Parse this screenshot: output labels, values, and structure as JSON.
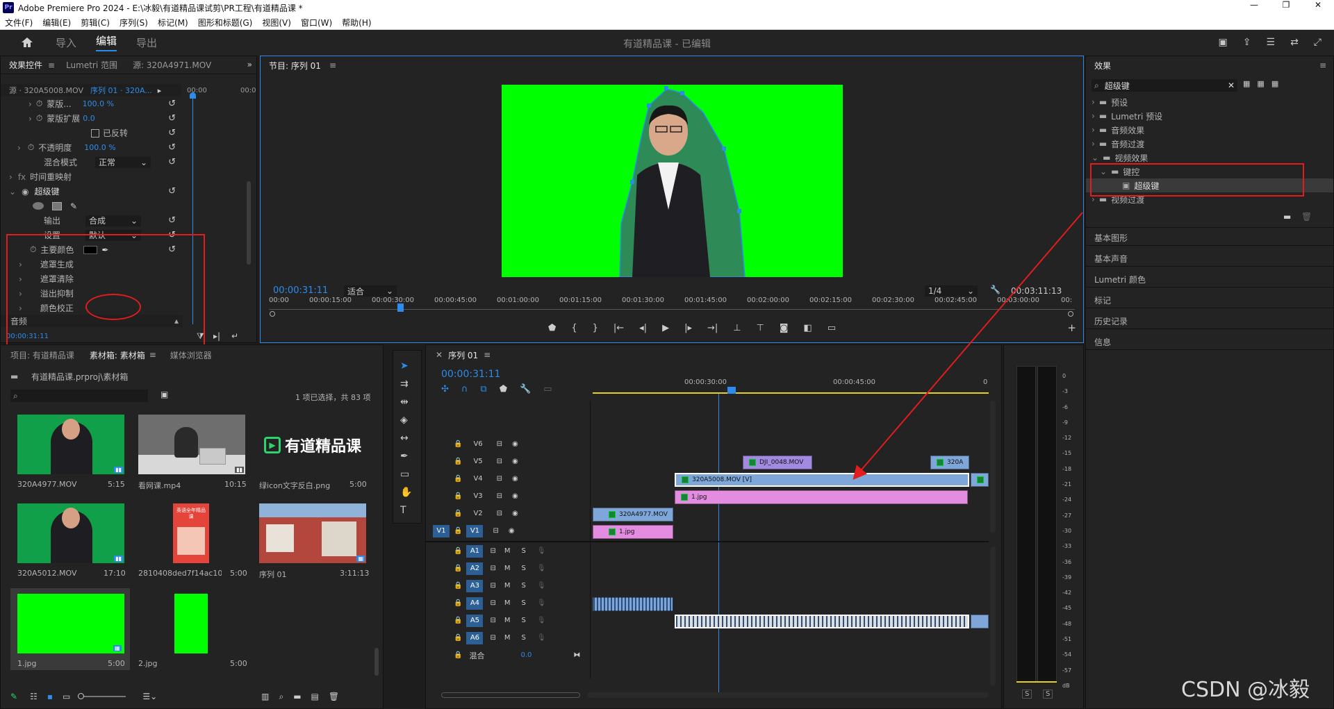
{
  "window": {
    "title": "Adobe Premiere Pro 2024 - E:\\冰毅\\有道精品课试剪\\PR工程\\有道精品课 *",
    "app_icon": "Pr"
  },
  "menu": [
    "文件(F)",
    "编辑(E)",
    "剪辑(C)",
    "序列(S)",
    "标记(M)",
    "图形和标题(G)",
    "视图(V)",
    "窗口(W)",
    "帮助(H)"
  ],
  "workspace": {
    "tabs": [
      "导入",
      "编辑",
      "导出"
    ],
    "active": "编辑",
    "project_title": "有道精品课 - 已编辑"
  },
  "effect_controls": {
    "tabs": [
      "效果控件",
      "Lumetri 范围",
      "源: 320A4971.MOV"
    ],
    "source_label": "源 · 320A5008.MOV",
    "sequence_label": "序列 01 · 320A...",
    "time_label": "00:00",
    "rows": [
      {
        "label": "蒙版...",
        "value": "100.0 %"
      },
      {
        "label": "蒙版扩展",
        "value": "0.0"
      },
      {
        "label": "已反转",
        "value": ""
      },
      {
        "label": "不透明度",
        "value": "100.0 %"
      },
      {
        "label": "混合模式",
        "value": "正常"
      },
      {
        "label": "时间重映射",
        "value": ""
      }
    ],
    "ultra_key": {
      "name": "超级键",
      "output_label": "输出",
      "output_value": "合成",
      "setting_label": "设置",
      "setting_value": "默认",
      "key_color_label": "主要颜色",
      "subitems": [
        "遮罩生成",
        "遮罩清除",
        "溢出抑制",
        "颜色校正"
      ]
    },
    "audio_label": "音频",
    "timecode": "00:00:31:11"
  },
  "program_monitor": {
    "title": "节目: 序列 01",
    "timecode": "00:00:31:11",
    "fit": "适合",
    "resolution": "1/4",
    "duration": "00:03:11:13",
    "ruler": [
      "00:00",
      "00:00:15:00",
      "00:00:30:00",
      "00:00:45:00",
      "00:01:00:00",
      "00:01:15:00",
      "00:01:30:00",
      "00:01:45:00",
      "00:02:00:00",
      "00:02:15:00",
      "00:02:30:00",
      "00:02:45:00",
      "00:03:00:00",
      "00:"
    ]
  },
  "effects_panel": {
    "title": "效果",
    "search": "超级键",
    "tree": [
      {
        "label": "预设"
      },
      {
        "label": "Lumetri 预设"
      },
      {
        "label": "音频效果"
      },
      {
        "label": "音频过渡"
      },
      {
        "label": "视频效果"
      },
      {
        "label": "键控"
      },
      {
        "label": "超级键"
      },
      {
        "label": "视频过渡"
      }
    ],
    "sections": [
      "基本图形",
      "基本声音",
      "Lumetri 颜色",
      "标记",
      "历史记录",
      "信息"
    ]
  },
  "project_panel": {
    "tabs": [
      "项目: 有道精品课",
      "素材箱: 素材箱",
      "媒体浏览器"
    ],
    "path": "有道精品课.prproj\\素材箱",
    "selection": "1 项已选择，共 83 项",
    "items": [
      {
        "name": "320A4977.MOV",
        "duration": "5:15"
      },
      {
        "name": "看网课.mp4",
        "duration": "10:15"
      },
      {
        "name": "绿icon文字反白.png",
        "duration": "5:00"
      },
      {
        "name": "320A5012.MOV",
        "duration": "17:10"
      },
      {
        "name": "2810408ded7f14ac10d...",
        "duration": "5:00"
      },
      {
        "name": "序列 01",
        "duration": "3:11:13"
      },
      {
        "name": "1.jpg",
        "duration": "5:00"
      },
      {
        "name": "2.jpg",
        "duration": "5:00"
      }
    ],
    "logo_text": "有道精品课",
    "poster_text": "英语全年精品课"
  },
  "timeline": {
    "title": "序列 01",
    "timecode": "00:00:31:11",
    "ruler": [
      "00:00:30:00",
      "00:00:45:00",
      "0"
    ],
    "video_tracks": [
      "V6",
      "V5",
      "V4",
      "V3",
      "V2",
      "V1"
    ],
    "audio_tracks": [
      "A1",
      "A2",
      "A3",
      "A4",
      "A5",
      "A6"
    ],
    "mix_label": "混合",
    "mix_value": "0.0",
    "source_patch": "V1",
    "clips": [
      {
        "label": "DJI_0048.MOV",
        "track": "V5"
      },
      {
        "label": "320A",
        "track": "V5"
      },
      {
        "label": "320A5008.MOV [V]",
        "track": "V4"
      },
      {
        "label": "1.jpg",
        "track": "V3"
      },
      {
        "label": "320A4977.MOV",
        "track": "V2"
      },
      {
        "label": "1.jpg",
        "track": "V1"
      }
    ]
  },
  "audio_meter": {
    "scale": [
      "0",
      "-3",
      "-6",
      "-9",
      "-12",
      "-15",
      "-18",
      "-21",
      "-24",
      "-27",
      "-30",
      "-33",
      "-36",
      "-39",
      "-42",
      "-45",
      "-48",
      "-51",
      "-54",
      "-57",
      "dB"
    ],
    "solo": [
      "S",
      "S"
    ]
  },
  "watermark": "CSDN @冰毅",
  "colors": {
    "accent": "#2d8ceb",
    "green_screen": "#00ff00",
    "annotation": "#e31c1c",
    "clip_pink": "#e38ce0",
    "clip_blue": "#7ea6d8",
    "clip_purple": "#a28ae0"
  }
}
